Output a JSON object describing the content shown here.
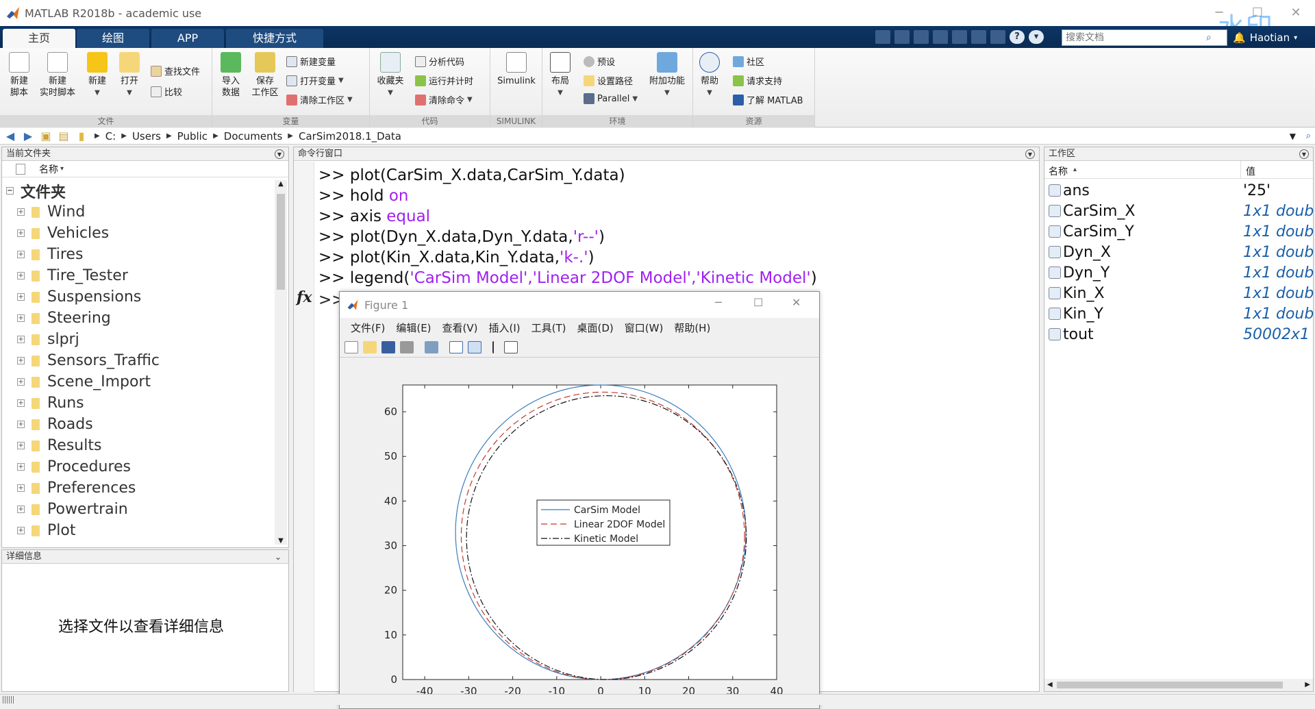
{
  "window": {
    "title": "MATLAB R2018b - academic use",
    "watermark": "水印"
  },
  "tabs": [
    {
      "label": "主页"
    },
    {
      "label": "绘图"
    },
    {
      "label": "APP"
    },
    {
      "label": "快捷方式"
    }
  ],
  "search": {
    "placeholder": "搜索文档"
  },
  "user": {
    "name": "Haotian"
  },
  "ribbon": {
    "file": {
      "group": "文件",
      "new_script": "新建\n脚本",
      "new_live": "新建\n实时脚本",
      "new": "新建",
      "open": "打开",
      "find_files": "查找文件",
      "compare": "比较"
    },
    "variable": {
      "group": "变量",
      "import": "导入\n数据",
      "save_ws": "保存\n工作区",
      "new_var": "新建变量",
      "open_var": "打开变量",
      "clear_ws": "清除工作区"
    },
    "code": {
      "group": "代码",
      "favorites": "收藏夹",
      "analyze": "分析代码",
      "run_time": "运行并计时",
      "clear_cmd": "清除命令"
    },
    "simulink": {
      "group": "SIMULINK",
      "simulink": "Simulink"
    },
    "env": {
      "group": "环境",
      "layout": "布局",
      "prefs": "预设",
      "set_path": "设置路径",
      "parallel": "Parallel",
      "addons": "附加功能"
    },
    "resources": {
      "group": "资源",
      "help": "帮助",
      "community": "社区",
      "support": "请求支持",
      "learn": "了解 MATLAB"
    }
  },
  "address": {
    "crumbs": [
      "C:",
      "Users",
      "Public",
      "Documents",
      "CarSim2018.1_Data"
    ]
  },
  "current_folder": {
    "title": "当前文件夹",
    "col_name": "名称",
    "root": "文件夹",
    "items": [
      "Wind",
      "Vehicles",
      "Tires",
      "Tire_Tester",
      "Suspensions",
      "Steering",
      "slprj",
      "Sensors_Traffic",
      "Scene_Import",
      "Runs",
      "Roads",
      "Results",
      "Procedures",
      "Preferences",
      "Powertrain",
      "Plot"
    ]
  },
  "details": {
    "title": "详细信息",
    "message": "选择文件以查看详细信息"
  },
  "command_window": {
    "title": "命令行窗口",
    "prompt": ">>",
    "fx": "fx",
    "lines": [
      {
        "a": "plot(CarSim_X.data,CarSim_Y.data)",
        "k": "",
        "b": ""
      },
      {
        "a": "hold ",
        "k": "on",
        "b": ""
      },
      {
        "a": "axis ",
        "k": "equal",
        "b": ""
      },
      {
        "a": "plot(Dyn_X.data,Dyn_Y.data,",
        "k": "'r--'",
        "b": ")"
      },
      {
        "a": "plot(Kin_X.data,Kin_Y.data,",
        "k": "'k-.'",
        "b": ")"
      },
      {
        "a": "legend(",
        "k": "'CarSim Model','Linear 2DOF Model','Kinetic Model'",
        "b": ")"
      }
    ]
  },
  "workspace": {
    "title": "工作区",
    "col_name": "名称",
    "col_value": "值",
    "vars": [
      {
        "name": "ans",
        "value": "'25'"
      },
      {
        "name": "CarSim_X",
        "value": "1x1 doub"
      },
      {
        "name": "CarSim_Y",
        "value": "1x1 doub"
      },
      {
        "name": "Dyn_X",
        "value": "1x1 doub"
      },
      {
        "name": "Dyn_Y",
        "value": "1x1 doub"
      },
      {
        "name": "Kin_X",
        "value": "1x1 doub"
      },
      {
        "name": "Kin_Y",
        "value": "1x1 doub"
      },
      {
        "name": "tout",
        "value": "50002x1 "
      }
    ]
  },
  "figure": {
    "title": "Figure 1",
    "menus": [
      "文件(F)",
      "编辑(E)",
      "查看(V)",
      "插入(I)",
      "工具(T)",
      "桌面(D)",
      "窗口(W)",
      "帮助(H)"
    ]
  },
  "chart_data": {
    "type": "line",
    "title": "",
    "xlabel": "",
    "ylabel": "",
    "xlim": [
      -45,
      40
    ],
    "ylim": [
      0,
      66
    ],
    "xticks": [
      -40,
      -30,
      -20,
      -10,
      0,
      10,
      20,
      30,
      40
    ],
    "yticks": [
      0,
      10,
      20,
      30,
      40,
      50,
      60
    ],
    "legend_location": "center",
    "series": [
      {
        "name": "CarSim Model",
        "style": "solid",
        "color": "#3b7dbf",
        "center": [
          0,
          33
        ],
        "radius": 33
      },
      {
        "name": "Linear 2DOF Model",
        "style": "dashed",
        "color": "#c0392b",
        "center": [
          0.5,
          32.2
        ],
        "radius": 32.2
      },
      {
        "name": "Kinetic Model",
        "style": "dashdot",
        "color": "#111111",
        "center": [
          1.3,
          31.8
        ],
        "radius": 31.8
      }
    ]
  }
}
